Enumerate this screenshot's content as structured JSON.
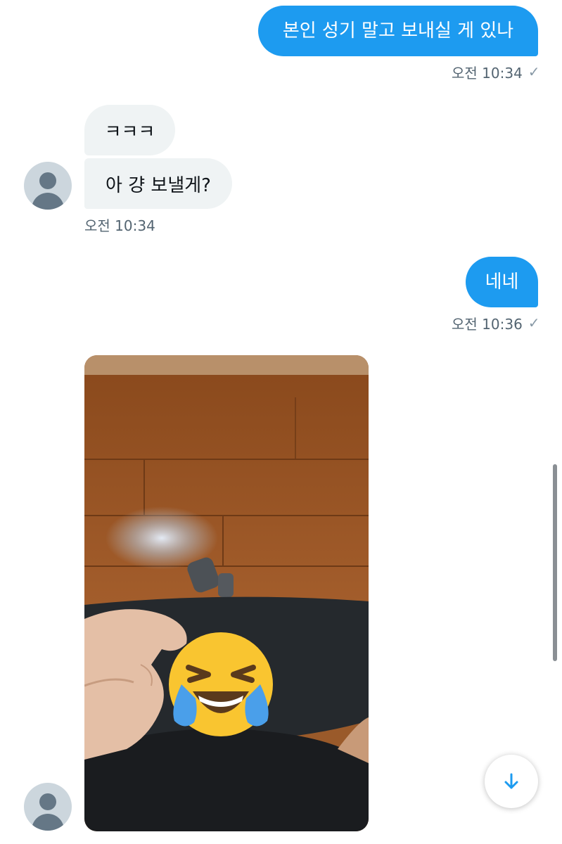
{
  "messages": {
    "out1": {
      "text": "본인 성기 말고 보내실 게 있나",
      "time": "오전 10:34"
    },
    "in1": {
      "text": "ㅋㅋㅋ"
    },
    "in2": {
      "text": "아 걍 보낼게?",
      "time": "오전 10:34"
    },
    "out2": {
      "text": "네네",
      "time": "오전 10:36"
    }
  },
  "read_receipt_icon": "check-icon",
  "scroll_button_icon": "arrow-down-icon",
  "colors": {
    "accent": "#1d9bf0",
    "incoming_bubble": "#eff3f4",
    "timestamp": "#536471"
  }
}
